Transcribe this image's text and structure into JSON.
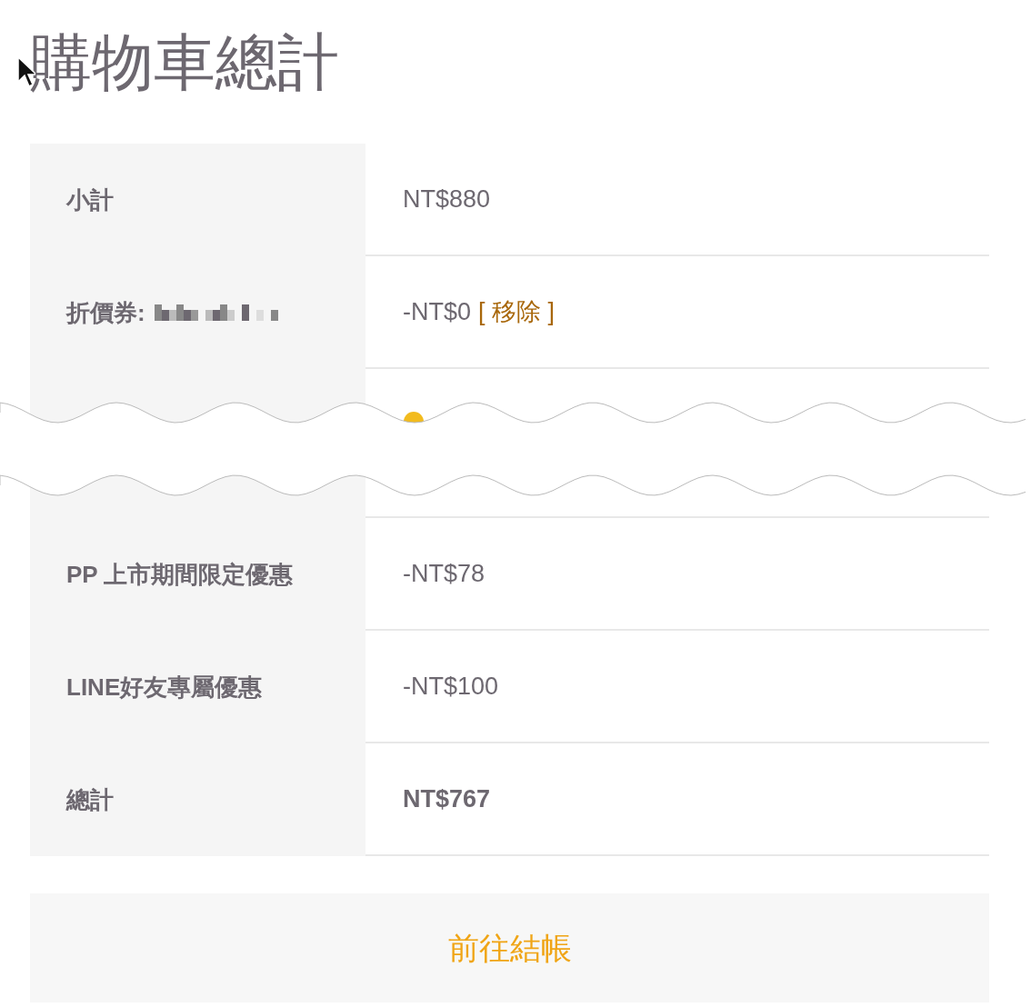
{
  "title": "購物車總計",
  "rows": [
    {
      "kind": "plain",
      "label": "小計",
      "value": "NT$880"
    },
    {
      "kind": "coupon",
      "label": "折價券:",
      "value": "-NT$0",
      "link": "[ 移除 ]"
    },
    {
      "kind": "torn"
    },
    {
      "kind": "plain",
      "label": "PP 上市期間限定優惠",
      "value": "-NT$78"
    },
    {
      "kind": "plain",
      "label": "LINE好友專屬優惠",
      "value": "-NT$100"
    },
    {
      "kind": "total",
      "label": "總計",
      "value": "NT$767"
    }
  ],
  "checkout_button": "前往結帳"
}
